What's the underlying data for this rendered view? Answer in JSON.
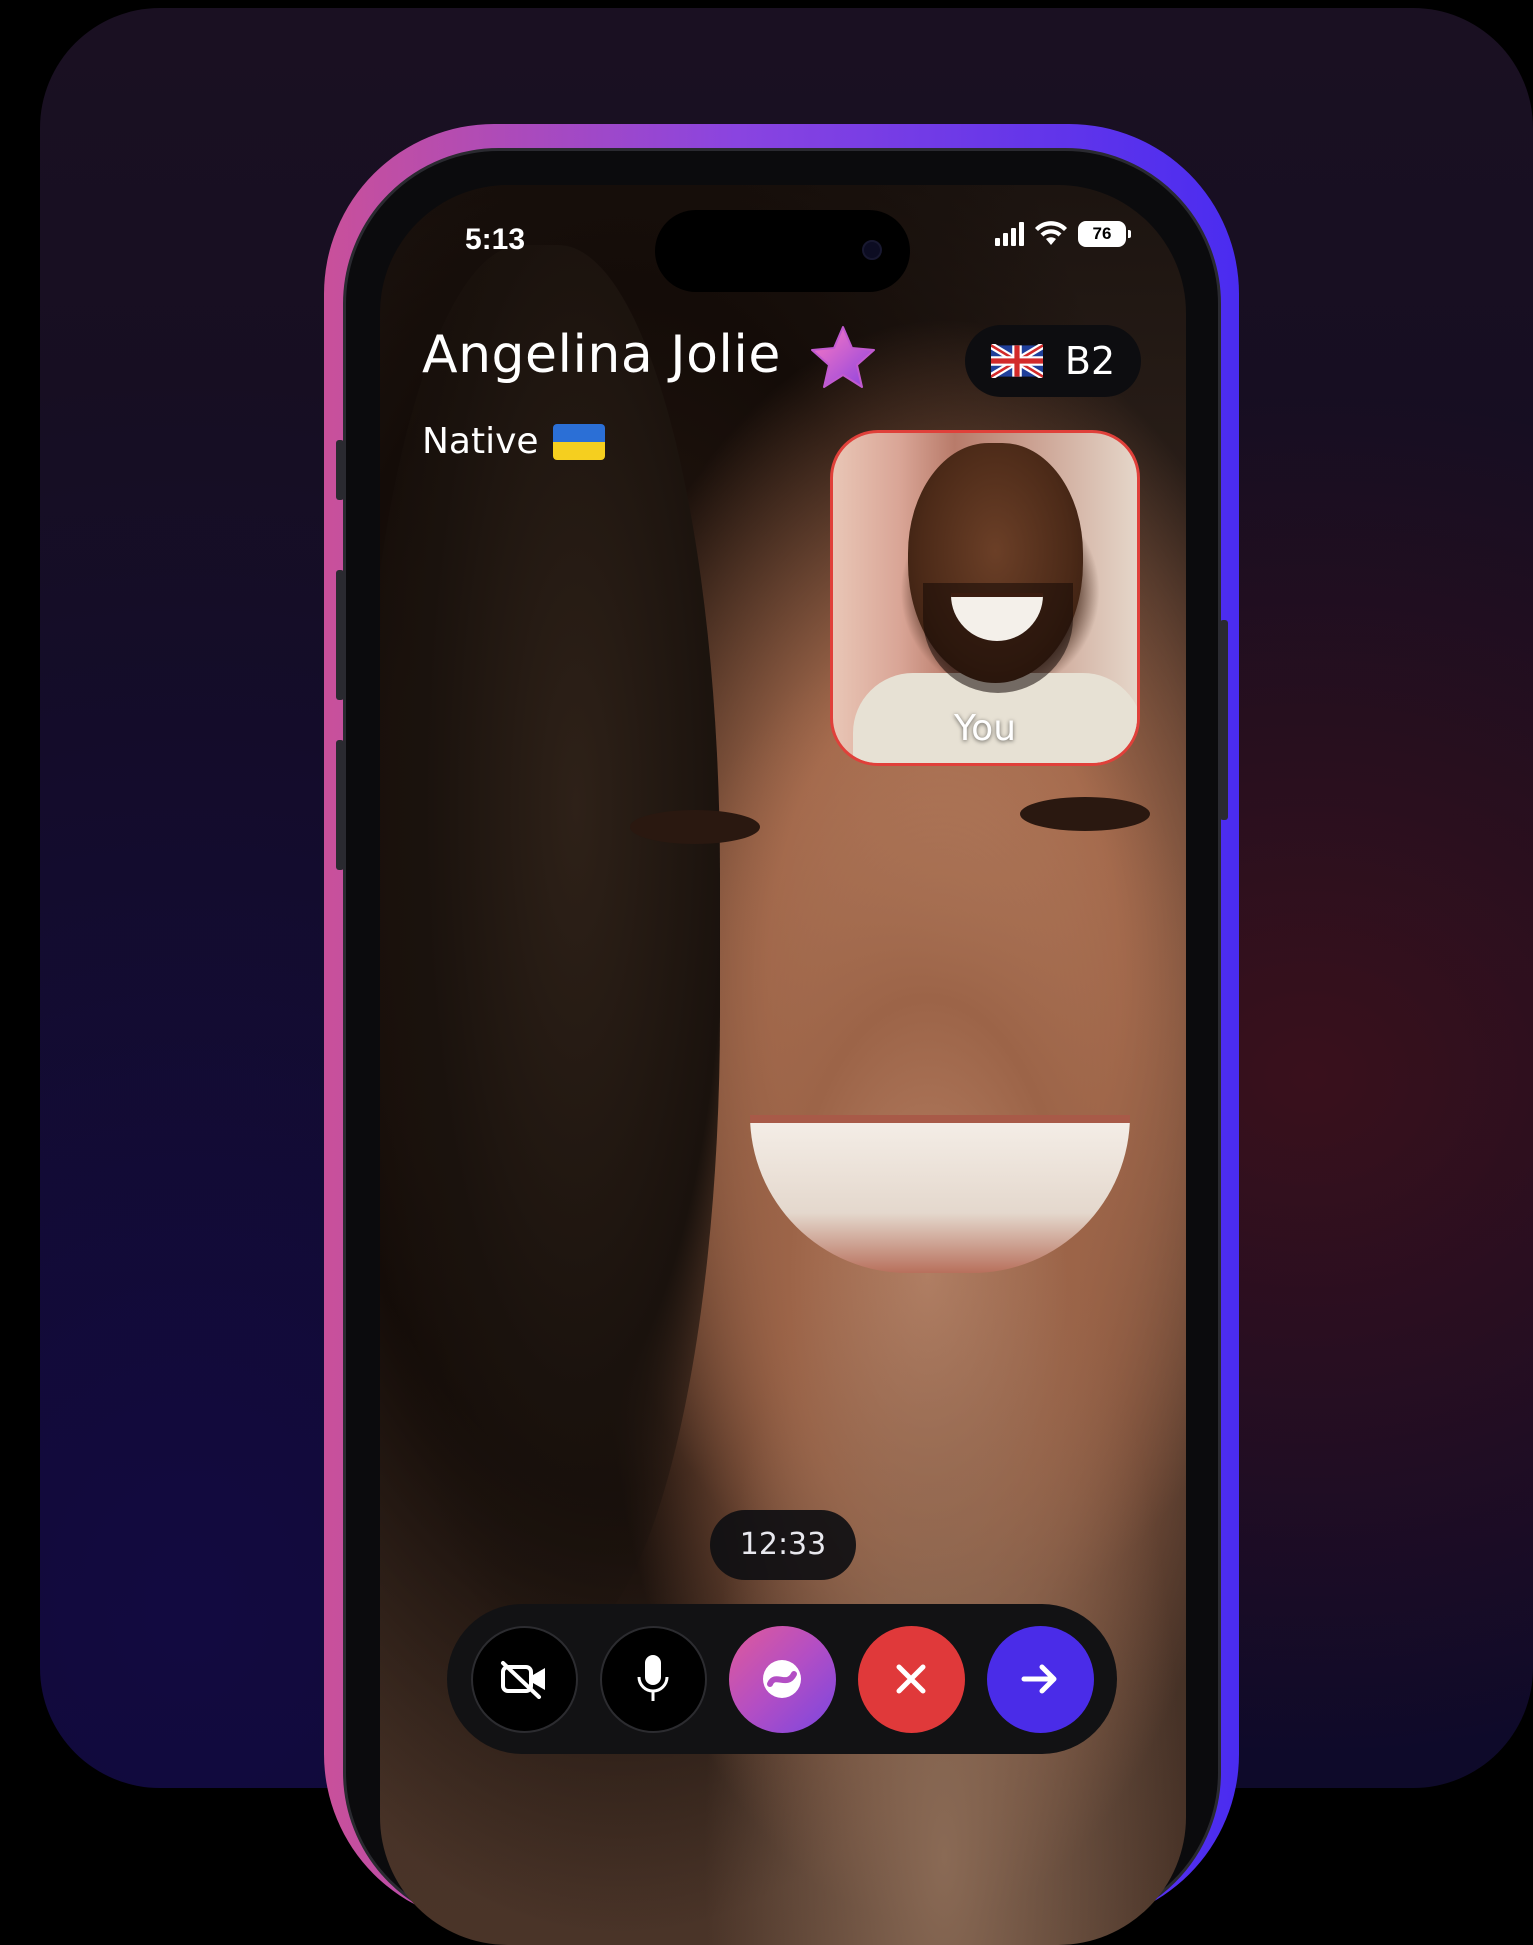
{
  "status_bar": {
    "time": "5:13",
    "battery": "76"
  },
  "caller": {
    "name": "Angelina Jolie",
    "badge_icon": "star-icon",
    "native_label": "Native",
    "native_flag": "ukraine-flag"
  },
  "level": {
    "flag": "uk-flag",
    "label": "B2"
  },
  "self_view": {
    "label": "You"
  },
  "call": {
    "timer": "12:33"
  },
  "controls": [
    {
      "name": "camera-off-button",
      "icon": "video-off-icon"
    },
    {
      "name": "microphone-button",
      "icon": "microphone-icon"
    },
    {
      "name": "app-action-button",
      "icon": "app-logo-icon"
    },
    {
      "name": "end-call-button",
      "icon": "close-icon"
    },
    {
      "name": "next-button",
      "icon": "arrow-right-icon"
    }
  ],
  "colors": {
    "accent_gradient_start": "#c9509a",
    "accent_gradient_end": "#4a2cf0",
    "end_call": "#e0393a",
    "next": "#4a2ce8",
    "self_view_border": "#e0403a"
  }
}
